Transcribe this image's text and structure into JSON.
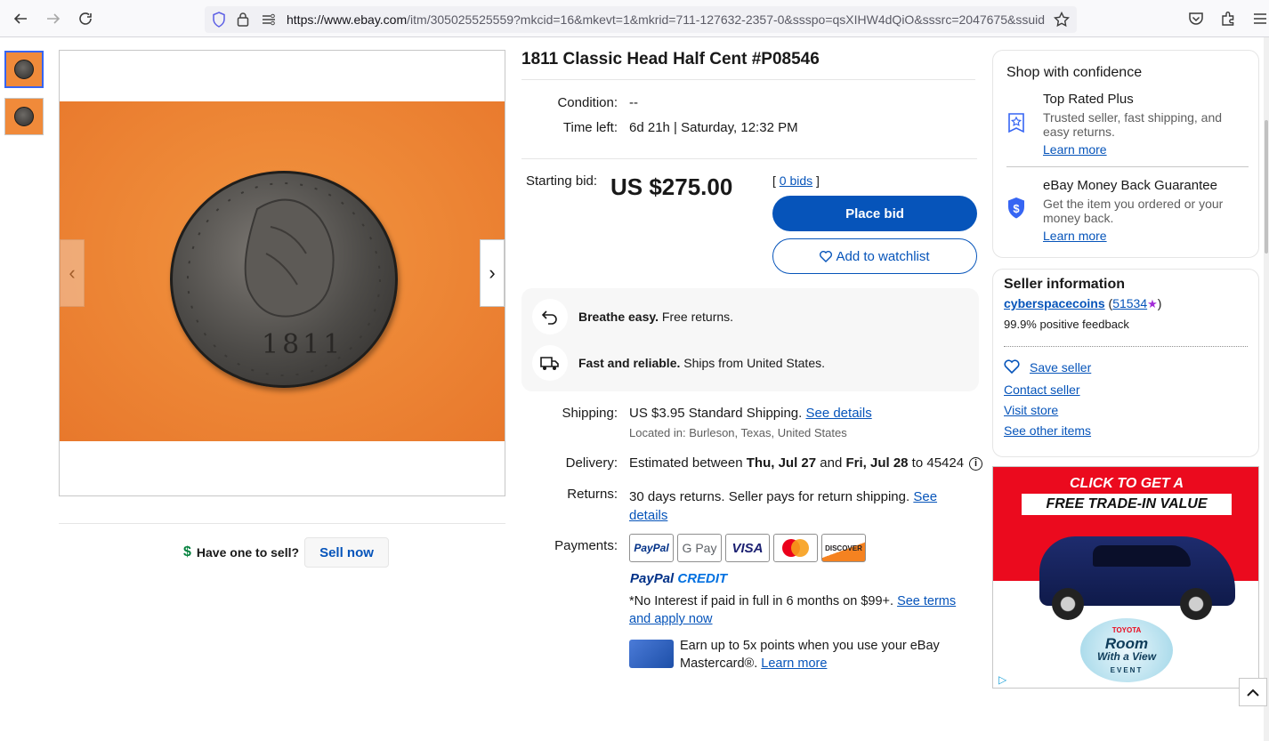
{
  "browser": {
    "url": "https://www.ebay.com/itm/305025525559?mkcid=16&mkevt=1&mkrid=711-127632-2357-0&ssspo=qsXIHW4dQiO&sssrc=2047675&ssuid=",
    "url_host": "https://www.ebay.com",
    "url_rest": "/itm/305025525559?mkcid=16&mkevt=1&mkrid=711-127632-2357-0&ssspo=qsXIHW4dQiO&sssrc=2047675&ssuid="
  },
  "gallery": {
    "coin_year": "1811",
    "next_arrow": "›",
    "prev_arrow": "‹"
  },
  "sell": {
    "question": "Have one to sell?",
    "button": "Sell now"
  },
  "item": {
    "title": "1811 Classic Head Half Cent #P08546",
    "condition_label": "Condition:",
    "condition_value": "--",
    "time_left_label": "Time left:",
    "time_left_value": "6d 21h | Saturday, 12:32 PM",
    "starting_bid_label": "Starting bid:",
    "price": "US $275.00",
    "bids_open": "[ ",
    "bids_link": "0 bids",
    "bids_close": " ]",
    "place_bid": "Place bid",
    "add_watchlist": "Add to watchlist"
  },
  "assurance": {
    "returns_bold": "Breathe easy.",
    "returns_text": " Free returns.",
    "shipping_bold": "Fast and reliable.",
    "shipping_text": " Ships from United States."
  },
  "shipping": {
    "label": "Shipping:",
    "cost": "US $3.95",
    "method": " Standard Shipping. ",
    "details_link": "See details",
    "location": "Located in: Burleson, Texas, United States"
  },
  "delivery": {
    "label": "Delivery:",
    "prefix": "Estimated between ",
    "date1": "Thu, Jul 27",
    "mid": " and ",
    "date2": "Fri, Jul 28",
    "suffix": " to 45424"
  },
  "returns": {
    "label": "Returns:",
    "text": "30 days returns. Seller pays for return shipping. ",
    "link": "See details"
  },
  "payments": {
    "label": "Payments:",
    "methods": [
      "PayPal",
      "G Pay",
      "VISA",
      "Mastercard",
      "DISCOVER"
    ],
    "paypal_credit_a": "PayPal",
    "paypal_credit_b": "CREDIT",
    "credit_text": "*No Interest if paid in full in 6 months on $99+. ",
    "credit_link": "See terms and apply now",
    "card_text": "Earn up to 5x points when you use your eBay Mastercard®. ",
    "card_link": "Learn more"
  },
  "confidence": {
    "heading": "Shop with confidence",
    "items": [
      {
        "title": "Top Rated Plus",
        "desc": "Trusted seller, fast shipping, and easy returns.",
        "link": "Learn more"
      },
      {
        "title": "eBay Money Back Guarantee",
        "desc": "Get the item you ordered or your money back.",
        "link": "Learn more"
      }
    ]
  },
  "seller": {
    "heading": "Seller information",
    "name": "cyberspacecoins",
    "score_open": " (",
    "score": "51534",
    "score_close": ")",
    "feedback": "99.9% positive feedback",
    "save": "Save seller",
    "contact": "Contact seller",
    "store": "Visit store",
    "other": "See other items"
  },
  "ad": {
    "line1": "CLICK TO GET A",
    "line2": "FREE TRADE-IN VALUE",
    "brand": "TOYOTA",
    "event1": "Room",
    "event2": "With a View",
    "event3": "EVENT"
  },
  "colors": {
    "primary_blue": "#0654ba",
    "accent_blue": "#3665f3",
    "ad_red": "#eb0a1e",
    "photo_orange": "#f08a3a"
  }
}
